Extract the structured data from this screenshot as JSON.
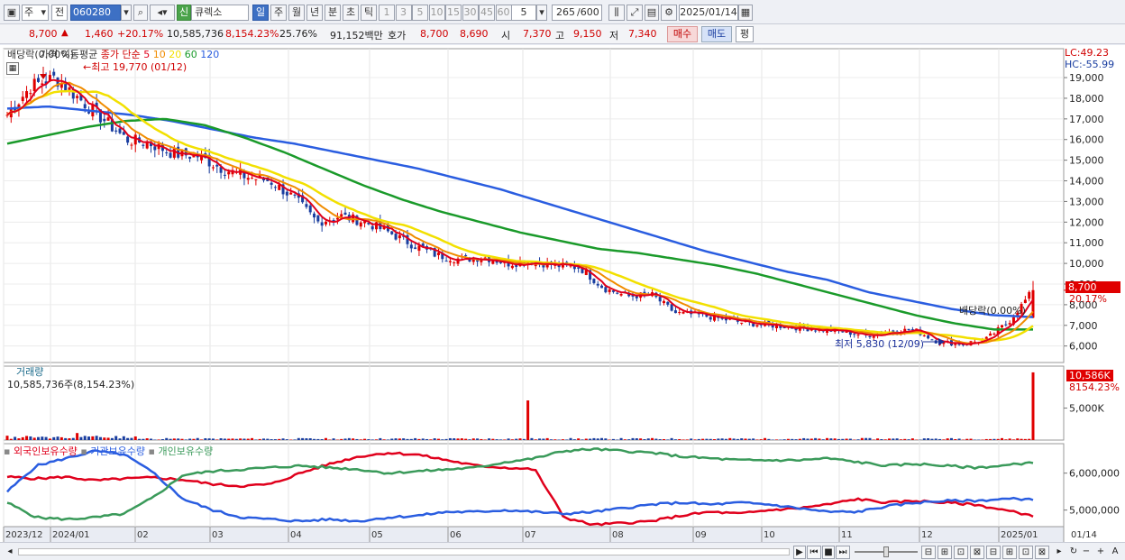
{
  "toolbar": {
    "period_type": "주",
    "prev_label": "전",
    "code": "060280",
    "new_label": "신",
    "name": "큐렉소",
    "periods": [
      "일",
      "주",
      "월",
      "년",
      "분",
      "초",
      "틱"
    ],
    "active_period": "일",
    "minute_options": [
      "1",
      "3",
      "5",
      "10",
      "15",
      "30",
      "45",
      "60"
    ],
    "minute_value": "5",
    "count": "265",
    "total": "/600",
    "date": "2025/01/14"
  },
  "quote": {
    "price": "8,700",
    "direction": "▲",
    "change": "1,460",
    "change_pct": "+20.17%",
    "volume": "10,585,736",
    "volume_pct": "8,154.23%",
    "turnover": "25.76%",
    "amount": "91,152백만",
    "bid_label": "호가",
    "bid1": "8,700",
    "bid2": "8,690",
    "open_label": "시",
    "open": "7,370",
    "high_label": "고",
    "high": "9,150",
    "low_label": "저",
    "low": "7,340",
    "buy_label": "매수",
    "sell_label": "매도",
    "eval_label": "평"
  },
  "panels": {
    "price_title": "배당락(0.00%)",
    "ma_label": "가격 이동평균",
    "ma_type": "종가 단순",
    "ma_periods": [
      "5",
      "10",
      "20",
      "60",
      "120"
    ],
    "ma_colors": [
      "#e0001c",
      "#f08c00",
      "#f2e000",
      "#1a9a2a",
      "#2a5de0"
    ],
    "high_note": "←최고 19,770 (01/12)",
    "low_note": "최저 5,830 (12/09)",
    "dividend_note": "배당락(0.00%)",
    "lc": "LC:49.23",
    "hc": "HC:-55.99",
    "last_price_tag": "8,700",
    "last_pct_tag": "20.17%",
    "volume_title": "거래량",
    "volume_info": "10,585,736주(8,154.23%)",
    "volume_tag": "10,586K",
    "volume_pct_tag": "8154.23%",
    "holding_titles": [
      "외국인보유수량",
      "기관보유수량",
      "개인보유수량"
    ],
    "holding_colors": [
      "#e0001c",
      "#2a5de0",
      "#3a9a5a"
    ]
  },
  "chart_data": [
    {
      "type": "candlestick",
      "title": "",
      "y_ticks": [
        6000,
        7000,
        8000,
        9000,
        10000,
        11000,
        12000,
        13000,
        14000,
        15000,
        16000,
        17000,
        18000,
        19000
      ],
      "y_tick_labels": [
        "6,000",
        "7,000",
        "8,000",
        "9,000",
        "10,000",
        "11,000",
        "12,000",
        "13,000",
        "14,000",
        "15,000",
        "16,000",
        "17,000",
        "18,000",
        "19,000"
      ],
      "ylim": [
        5200,
        20400
      ],
      "x_labels": [
        "2023/12",
        "2024/01",
        "02",
        "03",
        "04",
        "05",
        "06",
        "07",
        "08",
        "09",
        "10",
        "11",
        "12",
        "2025/01",
        "01/14"
      ],
      "close_path": [
        17200,
        18600,
        19000,
        18000,
        17000,
        16000,
        15800,
        15300,
        15200,
        14600,
        14200,
        14000,
        13200,
        12000,
        12300,
        12000,
        11500,
        10900,
        10400,
        10200,
        10300,
        10000,
        10100,
        9900,
        9800,
        8800,
        8400,
        8500,
        7600,
        7500,
        7300,
        7100,
        7000,
        6900,
        6800,
        6700,
        6500,
        6700,
        6800,
        6200,
        6100,
        6300,
        7200,
        8700
      ],
      "ma_120": [
        17500,
        17600,
        17400,
        17200,
        16900,
        16500,
        16100,
        15800,
        15400,
        15000,
        14600,
        14100,
        13600,
        13000,
        12400,
        11800,
        11200,
        10600,
        10100,
        9600,
        9200,
        8600,
        8200,
        7800,
        7500,
        7400
      ],
      "ma_60": [
        15800,
        16200,
        16600,
        16900,
        17000,
        16700,
        16100,
        15400,
        14600,
        13800,
        13100,
        12500,
        12000,
        11500,
        11100,
        10700,
        10500,
        10200,
        9900,
        9500,
        9000,
        8500,
        8000,
        7500,
        7100,
        6800,
        6800
      ],
      "last_price": 8700,
      "high": 19770,
      "low": 5830
    },
    {
      "type": "bar",
      "title": "거래량",
      "y_ticks": [
        5000
      ],
      "y_tick_labels": [
        "5,000K"
      ],
      "ylim": [
        0,
        11000
      ],
      "last_value_k": 10586,
      "spike_value_k": 6200
    },
    {
      "type": "line",
      "title": "",
      "y_ticks": [
        5000000,
        6000000
      ],
      "y_tick_labels": [
        "5,000,000",
        "6,000,000"
      ],
      "series": [
        {
          "name": "외국인보유수량",
          "color": "#e0001c"
        },
        {
          "name": "기관보유수량",
          "color": "#2a5de0"
        },
        {
          "name": "개인보유수량",
          "color": "#3a9a5a"
        }
      ]
    }
  ]
}
